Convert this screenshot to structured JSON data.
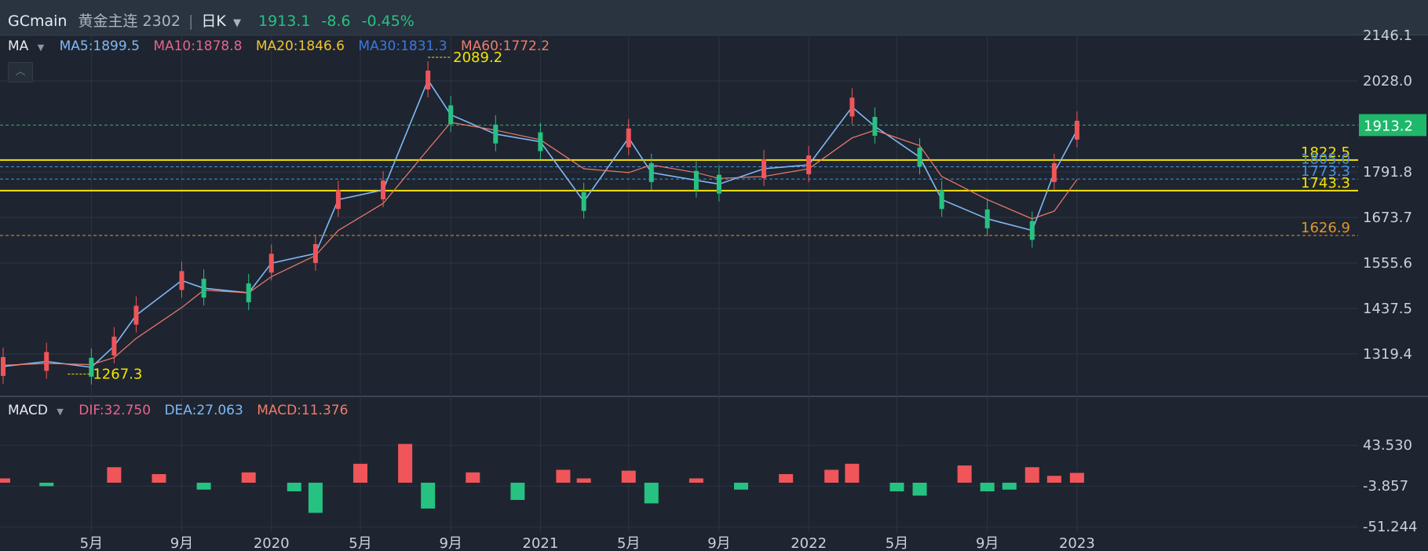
{
  "header": {
    "symbol": "GCmain",
    "name": "黄金主连 2302",
    "separator": "|",
    "period": "日K",
    "last": "1913.1",
    "change": "-8.6",
    "change_pct": "-0.45%"
  },
  "main_legend": {
    "indicator": "MA",
    "items": [
      {
        "label": "MA5:1899.5",
        "color": "#7fb8f5"
      },
      {
        "label": "MA10:1878.8",
        "color": "#e8648c"
      },
      {
        "label": "MA20:1846.6",
        "color": "#f3c32c"
      },
      {
        "label": "MA30:1831.3",
        "color": "#3a78e0"
      },
      {
        "label": "MA60:1772.2",
        "color": "#f07b6c"
      }
    ]
  },
  "macd_legend": {
    "indicator": "MACD",
    "items": [
      {
        "label": "DIF:32.750",
        "color": "#e8648c"
      },
      {
        "label": "DEA:27.063",
        "color": "#7fb8f5"
      },
      {
        "label": "MACD:11.376",
        "color": "#f07b6c"
      }
    ]
  },
  "price_axis": [
    "2146.1",
    "2028.0",
    "1791.8",
    "1673.7",
    "1555.6",
    "1437.5",
    "1319.4"
  ],
  "macd_axis": [
    "43.530",
    "-3.857",
    "-51.244"
  ],
  "x_axis": [
    "5月",
    "9月",
    "2020",
    "5月",
    "9月",
    "2021",
    "5月",
    "9月",
    "2022",
    "5月",
    "9月",
    "2023"
  ],
  "current_price_tag": "1913.2",
  "annotations": {
    "high": "2089.2",
    "low": "1267.3",
    "levels": [
      {
        "label": "1822.5",
        "color": "#f5e400"
      },
      {
        "label": "1805.0",
        "color": "#4a8fd8"
      },
      {
        "label": "1773.3",
        "color": "#4a8fd8"
      },
      {
        "label": "1743.3",
        "color": "#f5e400"
      },
      {
        "label": "1626.9",
        "color": "#e0962a"
      }
    ]
  },
  "colors": {
    "background": "#1e2530",
    "up": "#f0555a",
    "down": "#26c281",
    "grid": "#2c3542",
    "price_tag_bg": "#1fb86b"
  },
  "chart_data": {
    "type": "line",
    "title": "GCmain 黄金主连 2302 日K",
    "ylim": [
      1250,
      2160
    ],
    "x": [
      "2019-01",
      "2019-03",
      "2019-05",
      "2019-06",
      "2019-07",
      "2019-09",
      "2019-10",
      "2019-12",
      "2020-01",
      "2020-03",
      "2020-04",
      "2020-06",
      "2020-08",
      "2020-09",
      "2020-11",
      "2021-01",
      "2021-03",
      "2021-05",
      "2021-06",
      "2021-08",
      "2021-09",
      "2021-11",
      "2022-01",
      "2022-03",
      "2022-04",
      "2022-06",
      "2022-07",
      "2022-09",
      "2022-11",
      "2022-12",
      "2023-01"
    ],
    "series": [
      {
        "name": "MA5",
        "values": [
          1287,
          1300,
          1285,
          1340,
          1420,
          1510,
          1490,
          1478,
          1555,
          1580,
          1720,
          1745,
          2030,
          1940,
          1890,
          1870,
          1715,
          1880,
          1790,
          1770,
          1760,
          1800,
          1810,
          1960,
          1910,
          1830,
          1720,
          1670,
          1640,
          1790,
          1900
        ]
      },
      {
        "name": "MA60",
        "values": [
          1290,
          1295,
          1292,
          1310,
          1360,
          1440,
          1485,
          1478,
          1520,
          1575,
          1640,
          1710,
          1850,
          1920,
          1900,
          1875,
          1800,
          1790,
          1810,
          1790,
          1775,
          1780,
          1800,
          1880,
          1900,
          1860,
          1780,
          1720,
          1670,
          1690,
          1772
        ]
      }
    ],
    "levels": [
      2089.2,
      1913.2,
      1822.5,
      1805.0,
      1773.3,
      1743.3,
      1626.9,
      1267.3
    ],
    "macd": {
      "x": [
        "2019-01",
        "2019-03",
        "2019-06",
        "2019-08",
        "2019-10",
        "2019-12",
        "2020-02",
        "2020-03",
        "2020-05",
        "2020-07",
        "2020-08",
        "2020-10",
        "2020-12",
        "2021-02",
        "2021-03",
        "2021-05",
        "2021-06",
        "2021-08",
        "2021-10",
        "2021-12",
        "2022-02",
        "2022-03",
        "2022-05",
        "2022-06",
        "2022-08",
        "2022-09",
        "2022-10",
        "2022-11",
        "2022-12",
        "2023-01"
      ],
      "hist": [
        5,
        -4,
        18,
        10,
        -8,
        12,
        -10,
        -35,
        22,
        45,
        -30,
        12,
        -20,
        15,
        5,
        14,
        -24,
        5,
        -8,
        10,
        15,
        22,
        -10,
        -15,
        20,
        -10,
        -8,
        18,
        8,
        11.4
      ]
    }
  }
}
